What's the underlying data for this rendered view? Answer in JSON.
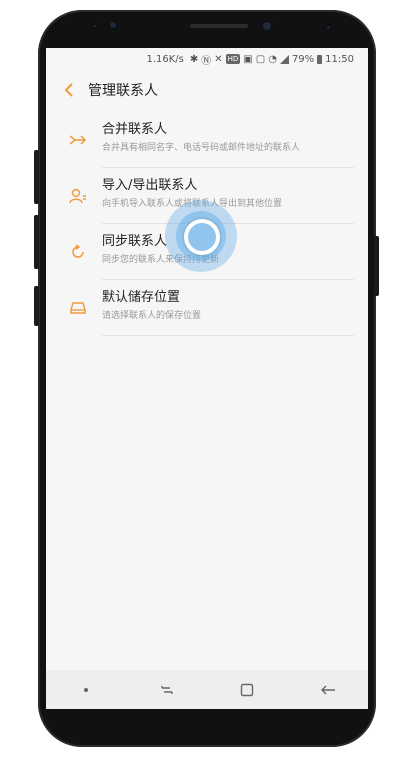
{
  "status_bar": {
    "speed": "1.16K/s",
    "badge_hd": "HD",
    "battery": "79%",
    "time": "11:50"
  },
  "app_bar": {
    "title": "管理联系人"
  },
  "menu": [
    {
      "title": "合并联系人",
      "subtitle": "合并具有相同名字、电话号码或邮件地址的联系人",
      "icon": "merge-icon"
    },
    {
      "title": "导入/导出联系人",
      "subtitle": "向手机导入联系人或将联系人导出到其他位置",
      "icon": "import-export-icon"
    },
    {
      "title": "同步联系人",
      "subtitle": "同步您的联系人来保持持更新",
      "icon": "sync-icon"
    },
    {
      "title": "默认储存位置",
      "subtitle": "请选择联系人的保存位置",
      "icon": "storage-icon"
    }
  ],
  "colors": {
    "accent": "#f29a3a",
    "screen_bg": "#f6f6f6",
    "touch": "#5aa5e6"
  }
}
